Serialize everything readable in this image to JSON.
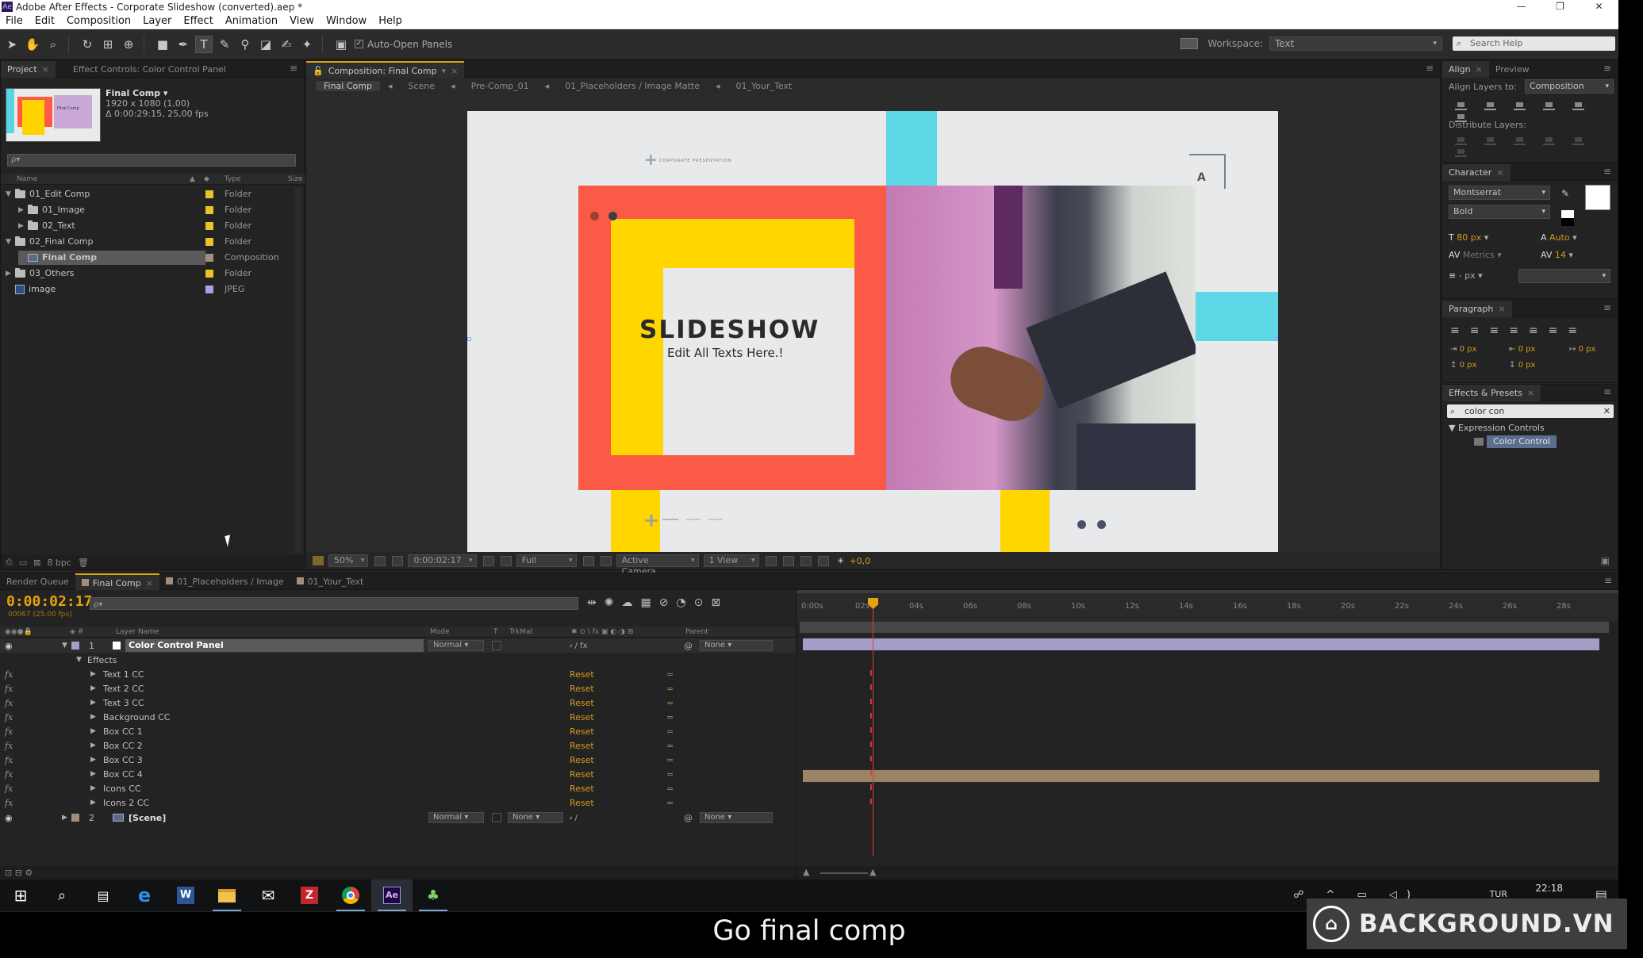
{
  "window": {
    "title": "Adobe After Effects - Corporate Slideshow (converted).aep *",
    "app_badge": "Ae",
    "controls": [
      "—",
      "❐",
      "✕"
    ]
  },
  "menu": [
    "File",
    "Edit",
    "Composition",
    "Layer",
    "Effect",
    "Animation",
    "View",
    "Window",
    "Help"
  ],
  "toolbar": {
    "tools": [
      "selection-tool",
      "hand-tool",
      "zoom-tool",
      "rotate-tool",
      "camera-tool",
      "pan-behind-tool",
      "rectangle-tool",
      "pen-tool",
      "type-tool",
      "brush-tool",
      "clone-tool",
      "eraser-tool",
      "roto-tool",
      "puppet-tool"
    ],
    "auto_open_label": "Auto-Open Panels",
    "workspace_label": "Workspace:",
    "workspace_value": "Text",
    "search_placeholder": "Search Help"
  },
  "project_panel": {
    "tabs": [
      {
        "label": "Project"
      },
      {
        "label": "Effect Controls: Color Control Panel"
      }
    ],
    "comp_name": "Final Comp ▾",
    "comp_info_1": "1920 x 1080 (1,00)",
    "comp_info_2": "Δ 0:00:29:15, 25,00 fps",
    "search_placeholder": "ρ▾",
    "thumb_caption": "Final Comp",
    "columns": {
      "name": "Name",
      "type": "Type",
      "size": "Size"
    },
    "items": [
      {
        "name": "01_Edit Comp",
        "type": "Folder",
        "indent": 0,
        "twisty": "▼",
        "icon": "folder-icon",
        "color": "#e8c32a"
      },
      {
        "name": "01_Image",
        "type": "Folder",
        "indent": 1,
        "twisty": "▶",
        "icon": "folder-icon",
        "color": "#e8c32a"
      },
      {
        "name": "02_Text",
        "type": "Folder",
        "indent": 1,
        "twisty": "▶",
        "icon": "folder-icon",
        "color": "#e8c32a"
      },
      {
        "name": "02_Final Comp",
        "type": "Folder",
        "indent": 0,
        "twisty": "▼",
        "icon": "folder-icon",
        "color": "#e8c32a"
      },
      {
        "name": "Final Comp",
        "type": "Composition",
        "indent": 1,
        "twisty": "",
        "icon": "comp-icon",
        "color": "#9f8f7b",
        "selected": true
      },
      {
        "name": "03_Others",
        "type": "Folder",
        "indent": 0,
        "twisty": "▶",
        "icon": "folder-icon",
        "color": "#e8c32a"
      },
      {
        "name": "image",
        "type": "JPEG",
        "indent": 0,
        "twisty": "",
        "icon": "img-icon",
        "color": "#a7a3dc"
      }
    ],
    "bpc": "8 bpc"
  },
  "comp_panel": {
    "tab": "Composition: Final Comp",
    "breadcrumbs": [
      "Final Comp",
      "Scene",
      "Pre-Comp_01",
      "01_Placeholders / Image Matte",
      "01_Your_Text"
    ],
    "canvas": {
      "small_title": "CORPORATE PRESENTATION",
      "headline": "SLIDESHOW",
      "subline": "Edit All Texts Here.!",
      "colors": {
        "red": "#fb5a46",
        "yellow": "#ffd600",
        "cyan": "#5ed8e6",
        "bg": "#e8e9ea",
        "gray": "#dadcde",
        "pink": "#d08fc4",
        "dark": "#3d4453"
      }
    },
    "viewbar": {
      "zoom": "50%",
      "timecode": "0:00:02:17",
      "resolution": "Full",
      "camera": "Active Camera",
      "views": "1 View",
      "exposure": "+0,0"
    }
  },
  "align_panel": {
    "tabs": [
      "Align",
      "Preview"
    ],
    "align_to_label": "Align Layers to:",
    "align_to_value": "Composition",
    "distribute_label": "Distribute Layers:"
  },
  "character_panel": {
    "tab": "Character",
    "font": "Montserrat",
    "style": "Bold",
    "size": "80 px",
    "leading": "Auto",
    "kerning": "Metrics",
    "tracking": "14",
    "stroke_unit": "- px",
    "fill_color": "#ffffff"
  },
  "paragraph_panel": {
    "tab": "Paragraph",
    "indent_values": [
      "0 px",
      "0 px",
      "0 px",
      "0 px",
      "0 px"
    ]
  },
  "effects_panel": {
    "tab": "Effects & Presets",
    "search_value": "color con",
    "category": "▼ Expression Controls",
    "result": "Color Control"
  },
  "timeline": {
    "tabs": [
      {
        "label": "Render Queue",
        "on": false
      },
      {
        "label": "Final Comp",
        "on": true
      },
      {
        "label": "01_Placeholders / Image",
        "on": false
      },
      {
        "label": "01_Your_Text",
        "on": false
      }
    ],
    "timecode": "0:00:02:17",
    "frames": "00067 (25.00 fps)",
    "columns": {
      "layer_name": "Layer Name",
      "mode": "Mode",
      "t": "T",
      "trkmat": "TrkMat",
      "parent": "Parent"
    },
    "layers": [
      {
        "num": "1",
        "name": "Color Control Panel",
        "mode": "Normal",
        "trkmat": "",
        "parent": "None",
        "color": "#e8e8e8"
      },
      {
        "num": "2",
        "name": "[Scene]",
        "mode": "Normal",
        "trkmat": "None",
        "parent": "None",
        "color": "#9f8f7b"
      }
    ],
    "effects_label": "Effects",
    "effects": [
      "Text 1 CC",
      "Text 2 CC",
      "Text 3 CC",
      "Background CC",
      "Box CC 1",
      "Box CC 2",
      "Box CC 3",
      "Box CC 4",
      "Icons CC",
      "Icons 2 CC"
    ],
    "reset_label": "Reset",
    "fx_label": "fx",
    "ruler_ticks": [
      "0:00s",
      "02s",
      "04s",
      "06s",
      "08s",
      "10s",
      "12s",
      "14s",
      "16s",
      "18s",
      "20s",
      "22s",
      "24s",
      "26s",
      "28s"
    ]
  },
  "taskbar": {
    "apps": [
      "start-icon",
      "search-icon",
      "task-view-icon",
      "edge-icon",
      "word-icon",
      "explorer-icon",
      "mail-icon",
      "filezilla-icon",
      "chrome-icon",
      "after-effects-icon",
      "app-icon"
    ],
    "lang": "TUR",
    "time": "22:18"
  },
  "subtitle": "Go final comp",
  "watermark": {
    "text": "BACKGROUND.VN"
  }
}
